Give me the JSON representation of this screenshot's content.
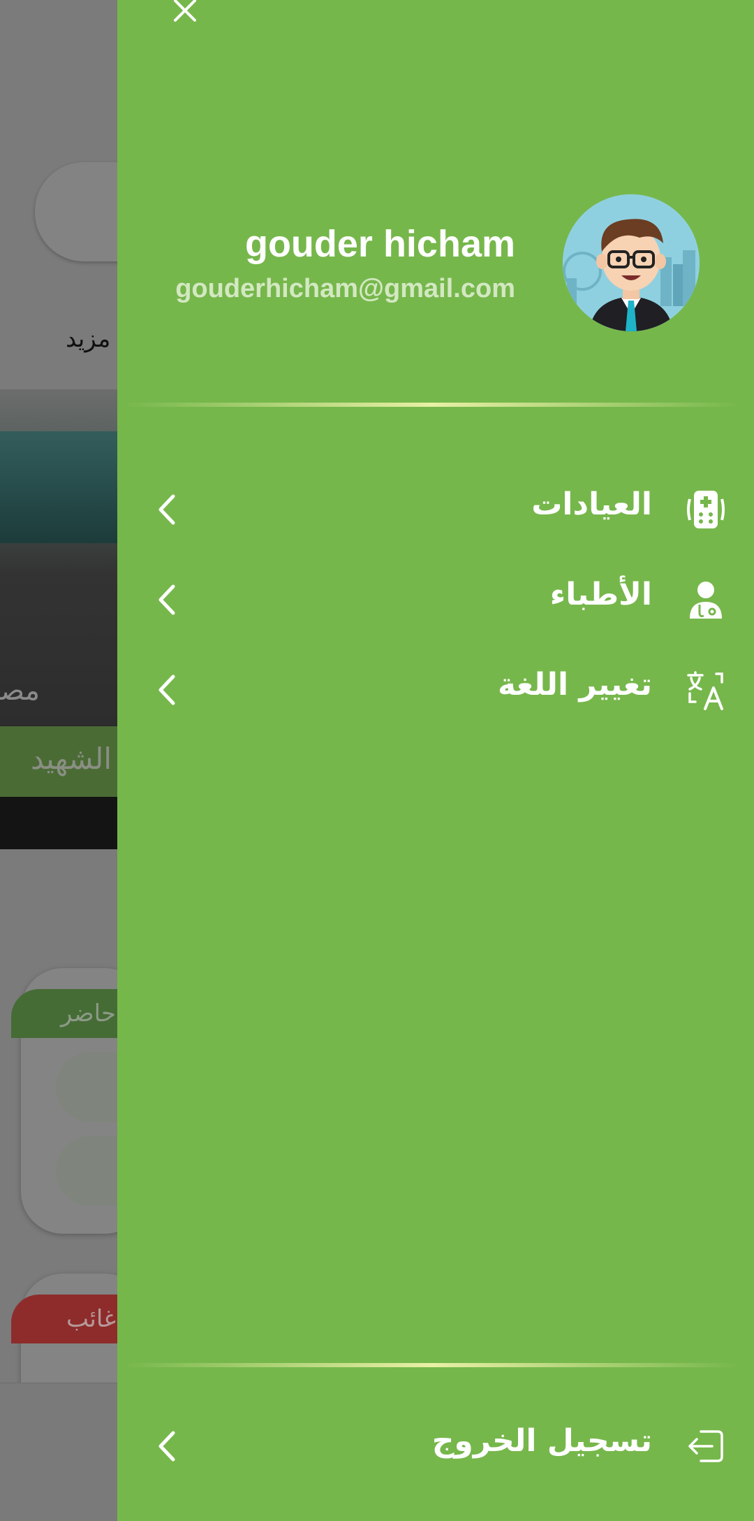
{
  "background": {
    "more_label": "مزيد",
    "photo_caption": "مصد",
    "banner_text": "الشهيد",
    "badge_present": "حاضر",
    "badge_absent": "غائب"
  },
  "drawer": {
    "profile": {
      "name": "gouder hicham",
      "email": "gouderhicham@gmail.com"
    },
    "menu": [
      {
        "label": "العيادات",
        "icon": "clinic-icon"
      },
      {
        "label": "الأطباء",
        "icon": "doctor-icon"
      },
      {
        "label": "تغيير اللغة",
        "icon": "translate-icon"
      }
    ],
    "logout_label": "تسجيل الخروج"
  },
  "colors": {
    "drawer_bg": "#76b74b",
    "divider": "#e9f0a6",
    "text": "#ffffff",
    "email": "#d3e8c2"
  }
}
